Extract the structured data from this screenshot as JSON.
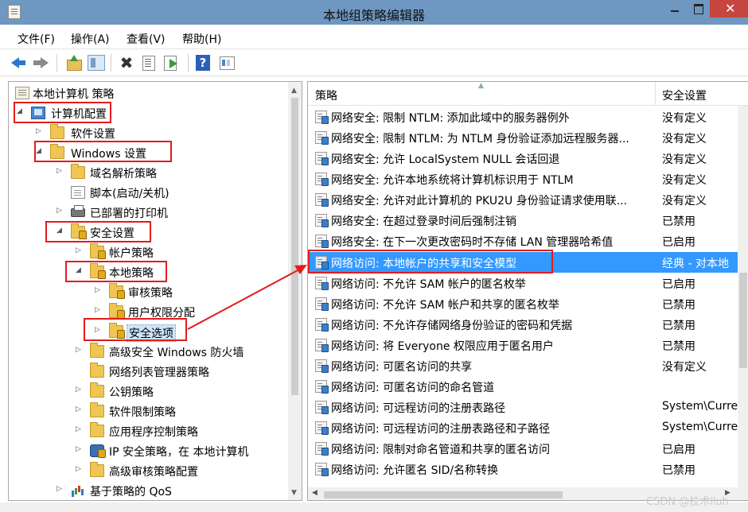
{
  "window": {
    "title": "本地组策略编辑器"
  },
  "menu": [
    "文件(F)",
    "操作(A)",
    "查看(V)",
    "帮助(H)"
  ],
  "toolbar": {
    "help_label": "?",
    "delete_label": "✖"
  },
  "tree": {
    "nodes": [
      {
        "label": "本地计算机 策略",
        "icon": "policy-root-icon",
        "twisty": ""
      },
      {
        "label": "计算机配置",
        "icon": "computer-icon",
        "twisty": "◢"
      },
      {
        "label": "软件设置",
        "icon": "folder-icon",
        "twisty": "▷"
      },
      {
        "label": "Windows 设置",
        "icon": "folder-icon",
        "twisty": "◢"
      },
      {
        "label": "域名解析策略",
        "icon": "folder-icon",
        "twisty": "▷"
      },
      {
        "label": "脚本(启动/关机)",
        "icon": "script-icon",
        "twisty": ""
      },
      {
        "label": "已部署的打印机",
        "icon": "printer-icon",
        "twisty": "▷"
      },
      {
        "label": "安全设置",
        "icon": "security-folder-icon",
        "twisty": "◢"
      },
      {
        "label": "帐户策略",
        "icon": "security-folder-icon",
        "twisty": "▷"
      },
      {
        "label": "本地策略",
        "icon": "security-folder-icon",
        "twisty": "◢"
      },
      {
        "label": "审核策略",
        "icon": "security-folder-icon",
        "twisty": "▷"
      },
      {
        "label": "用户权限分配",
        "icon": "security-folder-icon",
        "twisty": "▷"
      },
      {
        "label": "安全选项",
        "icon": "security-folder-icon",
        "twisty": "▷"
      },
      {
        "label": "高级安全 Windows 防火墙",
        "icon": "folder-icon",
        "twisty": "▷"
      },
      {
        "label": "网络列表管理器策略",
        "icon": "folder-icon",
        "twisty": ""
      },
      {
        "label": "公钥策略",
        "icon": "folder-icon",
        "twisty": "▷"
      },
      {
        "label": "软件限制策略",
        "icon": "folder-icon",
        "twisty": "▷"
      },
      {
        "label": "应用程序控制策略",
        "icon": "folder-icon",
        "twisty": "▷"
      },
      {
        "label": "IP 安全策略，在 本地计算机",
        "icon": "ipsec-icon",
        "twisty": "▷"
      },
      {
        "label": "高级审核策略配置",
        "icon": "folder-icon",
        "twisty": "▷"
      },
      {
        "label": "基于策略的 QoS",
        "icon": "qos-icon",
        "twisty": "▷"
      }
    ]
  },
  "list": {
    "col_policy": "策略",
    "col_setting": "安全设置",
    "rows": [
      {
        "policy": "网络安全: 限制 NTLM: 添加此域中的服务器例外",
        "setting": "没有定义"
      },
      {
        "policy": "网络安全: 限制 NTLM: 为 NTLM 身份验证添加远程服务器...",
        "setting": "没有定义"
      },
      {
        "policy": "网络安全: 允许 LocalSystem NULL 会话回退",
        "setting": "没有定义"
      },
      {
        "policy": "网络安全: 允许本地系统将计算机标识用于 NTLM",
        "setting": "没有定义"
      },
      {
        "policy": "网络安全: 允许对此计算机的 PKU2U 身份验证请求使用联...",
        "setting": "没有定义"
      },
      {
        "policy": "网络安全: 在超过登录时间后强制注销",
        "setting": "已禁用"
      },
      {
        "policy": "网络安全: 在下一次更改密码时不存储 LAN 管理器哈希值",
        "setting": "已启用"
      },
      {
        "policy": "网络访问: 本地帐户的共享和安全模型",
        "setting": "经典 - 对本地"
      },
      {
        "policy": "网络访问: 不允许 SAM 帐户的匿名枚举",
        "setting": "已启用"
      },
      {
        "policy": "网络访问: 不允许 SAM 帐户和共享的匿名枚举",
        "setting": "已禁用"
      },
      {
        "policy": "网络访问: 不允许存储网络身份验证的密码和凭据",
        "setting": "已禁用"
      },
      {
        "policy": "网络访问: 将 Everyone 权限应用于匿名用户",
        "setting": "已禁用"
      },
      {
        "policy": "网络访问: 可匿名访问的共享",
        "setting": "没有定义"
      },
      {
        "policy": "网络访问: 可匿名访问的命名管道",
        "setting": ""
      },
      {
        "policy": "网络访问: 可远程访问的注册表路径",
        "setting": "System\\Curre"
      },
      {
        "policy": "网络访问: 可远程访问的注册表路径和子路径",
        "setting": "System\\Curre"
      },
      {
        "policy": "网络访问: 限制对命名管道和共享的匿名访问",
        "setting": "已启用"
      },
      {
        "policy": "网络访问: 允许匿名 SID/名称转换",
        "setting": "已禁用"
      }
    ]
  },
  "watermark": "CSDN @技术lluh",
  "colors": {
    "annotation": "#e21c1c",
    "selection": "#3399ff",
    "titlebar": "#6e97c1"
  }
}
